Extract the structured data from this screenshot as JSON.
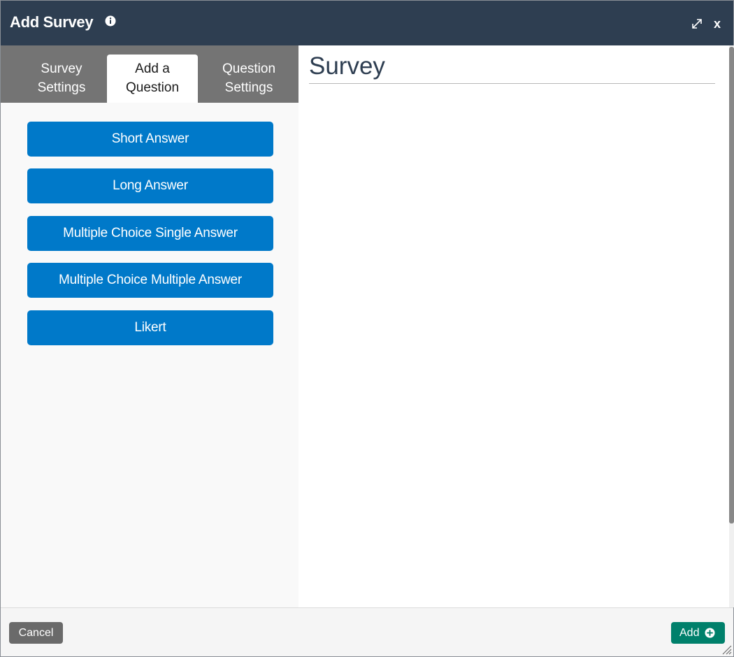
{
  "dialog": {
    "title": "Add Survey",
    "info_icon": "info-icon",
    "expand_icon": "expand-icon",
    "close_label": "x"
  },
  "tabs": [
    {
      "line1": "Survey",
      "line2": "Settings",
      "active": false
    },
    {
      "line1": "Add a",
      "line2": "Question",
      "active": true
    },
    {
      "line1": "Question",
      "line2": "Settings",
      "active": false
    }
  ],
  "question_types": [
    {
      "label": "Short Answer"
    },
    {
      "label": "Long Answer"
    },
    {
      "label": "Multiple Choice Single Answer"
    },
    {
      "label": "Multiple Choice Multiple Answer"
    },
    {
      "label": "Likert"
    }
  ],
  "preview": {
    "heading": "Survey"
  },
  "footer": {
    "cancel_label": "Cancel",
    "add_label": "Add",
    "add_icon": "plus-circle-icon"
  },
  "colors": {
    "titlebar": "#2e3e51",
    "tabbar": "#747474",
    "primary_button": "#0079c9",
    "add_button": "#00806b",
    "cancel_button": "#6a6a6a"
  }
}
